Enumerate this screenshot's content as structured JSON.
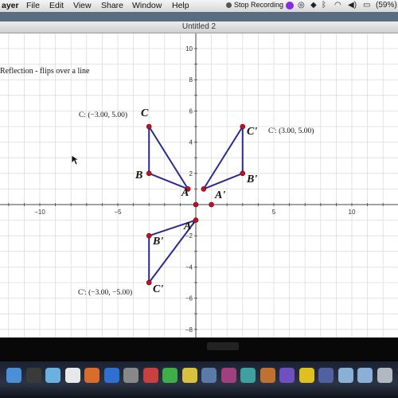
{
  "menubar": {
    "items": [
      "ayer",
      "File",
      "Edit",
      "View",
      "Share",
      "Window",
      "Help"
    ],
    "recording_label": "Stop Recording",
    "battery_label": "(59%)"
  },
  "window": {
    "title": "Untitled 2"
  },
  "sketch": {
    "heading": "Reflection - flips over a line",
    "x_ticks": [
      "−10",
      "−5",
      "5",
      "10"
    ],
    "y_ticks": [
      "10",
      "8",
      "6",
      "4",
      "2",
      "−2",
      "−4",
      "−6",
      "−8"
    ],
    "points": [
      {
        "label": "C",
        "x": -3,
        "y": 5
      },
      {
        "label": "B",
        "x": -3,
        "y": 2
      },
      {
        "label": "A",
        "x": -0.5,
        "y": 1
      },
      {
        "label": "C'",
        "x": 3,
        "y": 5
      },
      {
        "label": "B'",
        "x": 3,
        "y": 2
      },
      {
        "label": "A'",
        "x": 0.5,
        "y": 1
      },
      {
        "label": "A'",
        "x": 0,
        "y": -1
      },
      {
        "label": "B'",
        "x": -3,
        "y": -2
      },
      {
        "label": "C'",
        "x": -3,
        "y": -5
      }
    ],
    "axis_points": [
      {
        "x": 0,
        "y": 0
      },
      {
        "x": 1,
        "y": 0
      }
    ],
    "measurements": {
      "c": "C: (−3.00, 5.00)",
      "c_prime_right": "C': (3.00, 5.00)",
      "c_prime_bottom": "C': (−3.00, −5.00)"
    },
    "label_text": {
      "C": "C",
      "B": "B",
      "A": "A",
      "C2": "C'",
      "B2": "B'",
      "A2": "A'",
      "A3": "A'",
      "B3": "B'",
      "C3": "C'"
    }
  },
  "colors": {
    "segment": "#2b2b8c",
    "point": "#c0102a",
    "grid": "#dcdcdc",
    "axis": "#444444"
  },
  "dock_icons": [
    "finder-icon",
    "dashboard-icon",
    "mail-icon",
    "calendar-icon",
    "photos-icon",
    "itunes-icon",
    "preferences-icon",
    "app-icon",
    "app-icon",
    "app-icon",
    "timemachine-icon",
    "app-icon",
    "app-icon",
    "app-icon",
    "app-icon",
    "chrome-icon",
    "app-icon",
    "folder-icon",
    "folder-icon",
    "trash-icon"
  ]
}
